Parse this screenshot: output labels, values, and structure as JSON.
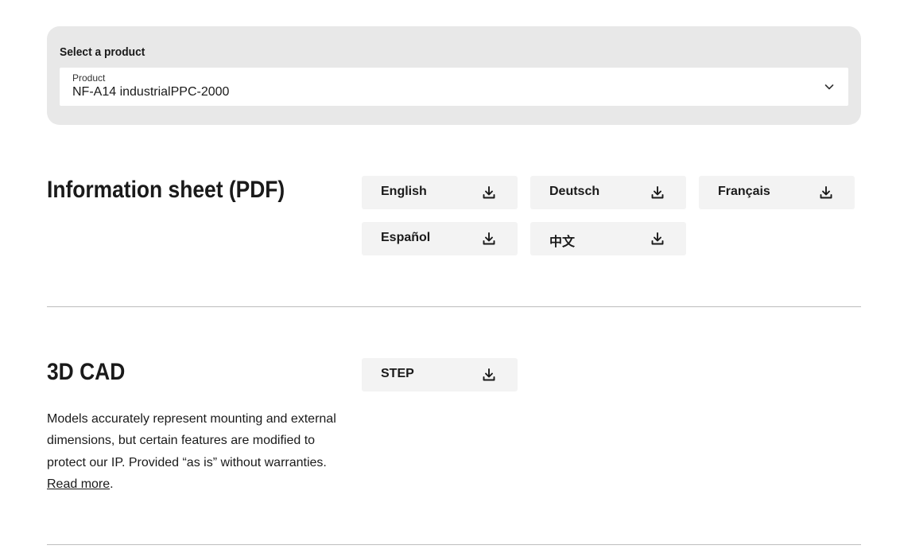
{
  "selector": {
    "heading": "Select a product",
    "field_label": "Product",
    "selected_value": "NF-A14 industrialPPC-2000"
  },
  "info_sheet": {
    "title": "Information sheet (PDF)",
    "languages": [
      {
        "label": "English"
      },
      {
        "label": "Deutsch"
      },
      {
        "label": "Français"
      },
      {
        "label": "Español"
      },
      {
        "label": "中文"
      }
    ]
  },
  "cad": {
    "title": "3D CAD",
    "formats": [
      {
        "label": "STEP"
      }
    ],
    "description": "Models accurately represent mounting and external dimensions, but certain features are modified to protect our IP. Provided “as is” without warranties.",
    "read_more": "Read more",
    "trailing_punct": "."
  },
  "icons": {
    "download": "download-icon",
    "dropdown": "chevron-down-icon"
  },
  "colors": {
    "panel_bg": "#e8e8e8",
    "button_bg": "#f3f3f3",
    "text": "#1a1a1a",
    "divider": "#bdbdbd"
  }
}
